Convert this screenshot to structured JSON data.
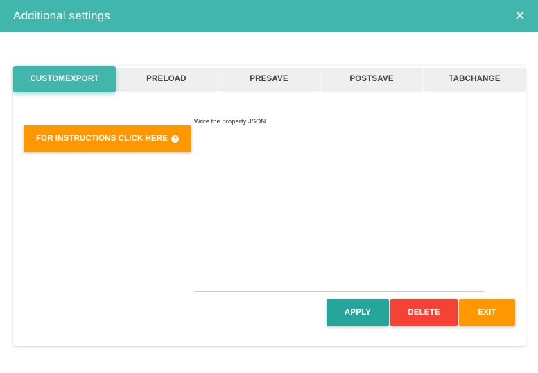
{
  "window": {
    "title": "Additional settings",
    "close_icon": "close-icon"
  },
  "tabs": [
    {
      "label": "CUSTOMEXPORT",
      "active": true
    },
    {
      "label": "PRELOAD",
      "active": false
    },
    {
      "label": "PRESAVE",
      "active": false
    },
    {
      "label": "POSTSAVE",
      "active": false
    },
    {
      "label": "TABCHANGE",
      "active": false
    }
  ],
  "instructions": {
    "label": "FOR INSTRUCTIONS CLICK HERE",
    "icon": "question-icon",
    "icon_glyph": "?"
  },
  "editor": {
    "label": "Write the property JSON",
    "value": ""
  },
  "actions": {
    "apply": "APPLY",
    "delete": "DELETE",
    "exit": "EXIT"
  },
  "colors": {
    "accent": "#41b6ac",
    "apply": "#26a69a",
    "delete": "#f44336",
    "warning": "#ff9800"
  }
}
